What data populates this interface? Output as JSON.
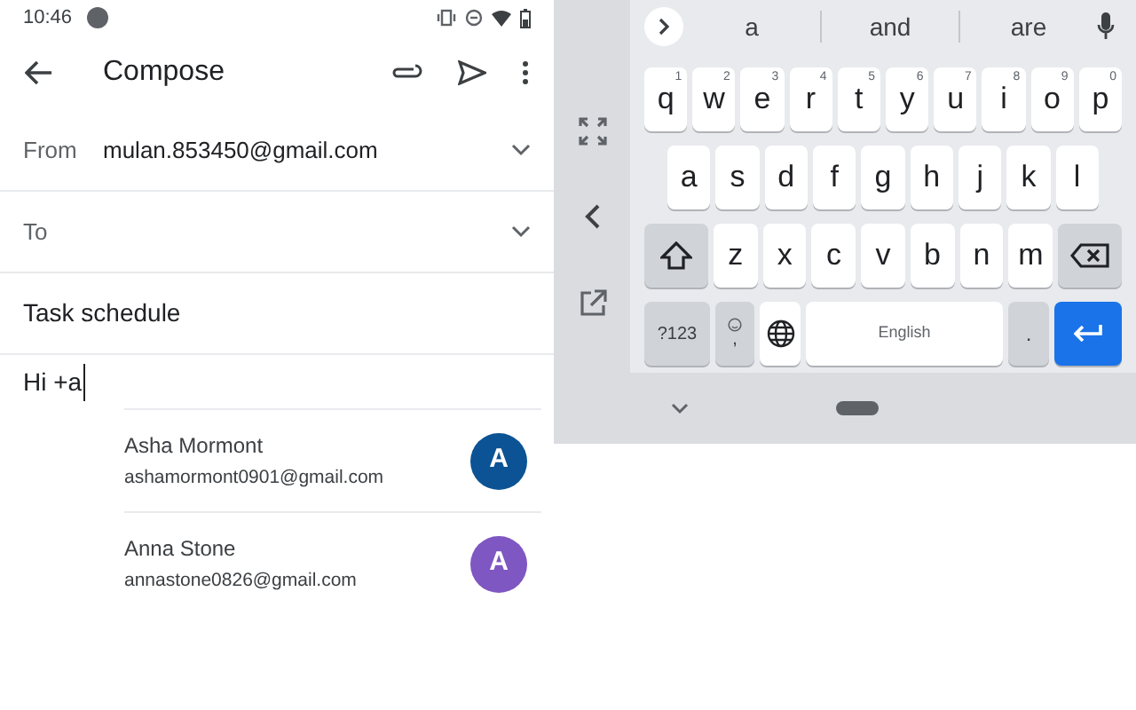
{
  "status_bar": {
    "time": "10:46"
  },
  "app_bar": {
    "title": "Compose"
  },
  "fields": [
    {
      "label": "From",
      "value": "mulan.853450@gmail.com"
    },
    {
      "label": "To"
    }
  ],
  "subject": "Task schedule",
  "body": "Hi +a",
  "contact_suggestions": [
    {
      "name": "Asha Mormont",
      "email": "ashamormont0901@gmail.com",
      "initial": "A",
      "color": "#0b5394"
    },
    {
      "name": "Anna Stone",
      "email": "annastone0826@gmail.com",
      "initial": "A",
      "color": "#7e57c2"
    }
  ],
  "keyboard": {
    "suggestions": [
      "a",
      "and",
      "are"
    ],
    "rows": [
      [
        {
          "kind": "letter",
          "label": "q",
          "hint": "1"
        },
        {
          "kind": "letter",
          "label": "w",
          "hint": "2"
        },
        {
          "kind": "letter",
          "label": "e",
          "hint": "3"
        },
        {
          "kind": "letter",
          "label": "r",
          "hint": "4"
        },
        {
          "kind": "letter",
          "label": "t",
          "hint": "5"
        },
        {
          "kind": "letter",
          "label": "y",
          "hint": "6"
        },
        {
          "kind": "letter",
          "label": "u",
          "hint": "7"
        },
        {
          "kind": "letter",
          "label": "i",
          "hint": "8"
        },
        {
          "kind": "letter",
          "label": "o",
          "hint": "9"
        },
        {
          "kind": "letter",
          "label": "p",
          "hint": "0"
        }
      ],
      [
        {
          "kind": "letter",
          "label": "a"
        },
        {
          "kind": "letter",
          "label": "s"
        },
        {
          "kind": "letter",
          "label": "d"
        },
        {
          "kind": "letter",
          "label": "f"
        },
        {
          "kind": "letter",
          "label": "g"
        },
        {
          "kind": "letter",
          "label": "h"
        },
        {
          "kind": "letter",
          "label": "j"
        },
        {
          "kind": "letter",
          "label": "k"
        },
        {
          "kind": "letter",
          "label": "l"
        }
      ],
      [
        {
          "kind": "shift"
        },
        {
          "kind": "letter",
          "label": "z"
        },
        {
          "kind": "letter",
          "label": "x"
        },
        {
          "kind": "letter",
          "label": "c"
        },
        {
          "kind": "letter",
          "label": "v"
        },
        {
          "kind": "letter",
          "label": "b"
        },
        {
          "kind": "letter",
          "label": "n"
        },
        {
          "kind": "letter",
          "label": "m"
        },
        {
          "kind": "backspace"
        }
      ]
    ],
    "bottom_row": [
      {
        "kind": "symbols",
        "label": "?123"
      },
      {
        "kind": "emoji",
        "label": ","
      },
      {
        "kind": "globe"
      },
      {
        "kind": "space",
        "label": "English"
      },
      {
        "kind": "period",
        "label": "."
      },
      {
        "kind": "enter"
      }
    ]
  }
}
